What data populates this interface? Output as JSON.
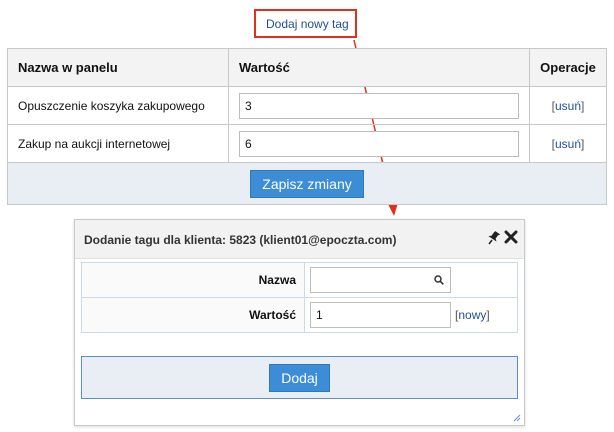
{
  "add_tag": {
    "label": "Dodaj nowy tag"
  },
  "table": {
    "headers": {
      "name": "Nazwa w panelu",
      "value": "Wartość",
      "operations": "Operacje"
    },
    "rows": [
      {
        "name": "Opuszczenie koszyka zakupowego",
        "value": "3",
        "remove_label": "usuń"
      },
      {
        "name": "Zakup na aukcji internetowej",
        "value": "6",
        "remove_label": "usuń"
      }
    ],
    "save_label": "Zapisz zmiany"
  },
  "dialog": {
    "title": "Dodanie tagu dla klienta: 5823 (klient01@epoczta.com)",
    "name_label": "Nazwa",
    "name_value": "",
    "value_label": "Wartość",
    "value_value": "1",
    "new_label": "nowy",
    "add_label": "Dodaj"
  },
  "colors": {
    "accent": "#3d8dd6",
    "highlight": "#e0301e",
    "link": "#1f4f9a"
  },
  "icons": [
    "pin-icon",
    "close-icon",
    "search-icon",
    "resize-grip-icon"
  ]
}
